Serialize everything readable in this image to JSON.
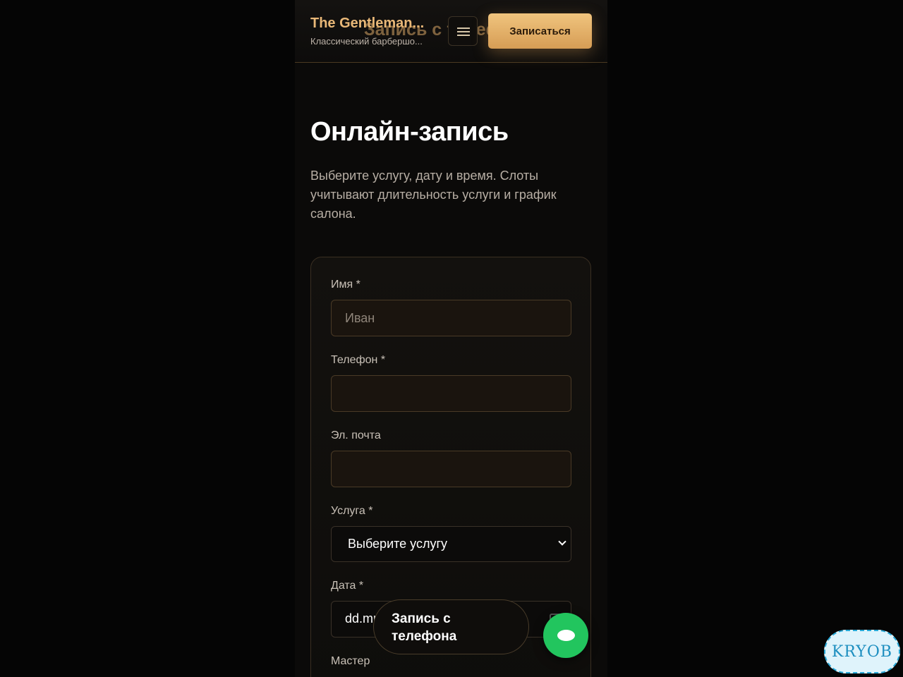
{
  "header": {
    "brand_name": "The Gentleman...",
    "brand_tagline": "Классический барбершо...",
    "overlay_title": "Запись с телефона",
    "menu_icon": "hamburger-menu-icon",
    "book_label": "Записаться"
  },
  "hero": {
    "title": "Онлайн-запись",
    "subtitle": "Выберите услугу, дату и время. Слоты учитывают длительность услуги и график салона."
  },
  "form": {
    "name_label": "Имя *",
    "name_placeholder": "Иван",
    "phone_label": "Телефон *",
    "phone_value": "",
    "email_label": "Эл. почта",
    "email_value": "",
    "service_label": "Услуга *",
    "service_value": "Выберите услугу",
    "date_label": "Дата *",
    "date_value": "dd.mm.yyyy",
    "master_label": "Мастер"
  },
  "floating": {
    "phone_booking_label": "Запись с телефона",
    "chat_icon": "chat-bubble-icon"
  },
  "watermark": {
    "text": "KRYOB"
  },
  "colors": {
    "accent": "#e9b878",
    "button": "#e0ac66",
    "fab": "#22c55e",
    "background": "#0b0a09"
  }
}
